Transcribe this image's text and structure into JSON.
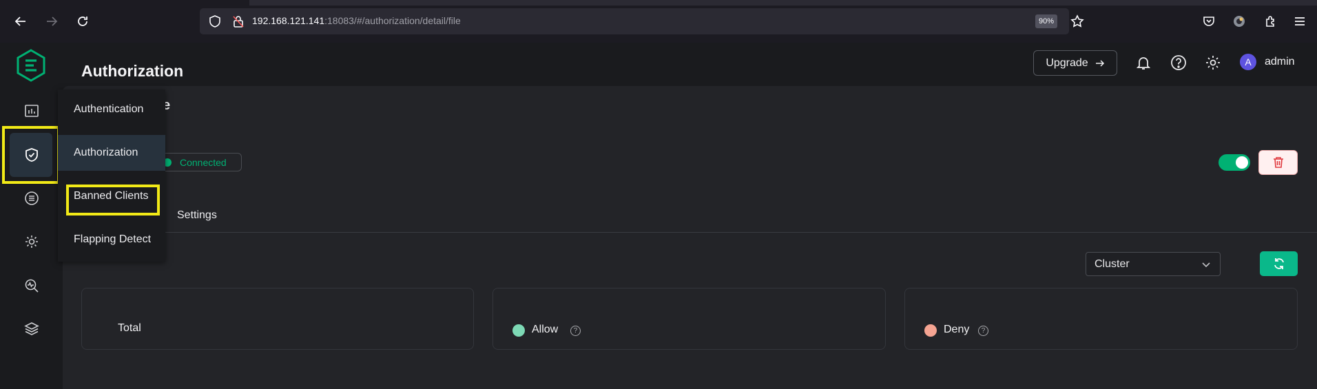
{
  "browser": {
    "url_host": "192.168.121.141",
    "url_rest": ":18083/#/authorization/detail/file",
    "zoom": "90%"
  },
  "header": {
    "upgrade_label": "Upgrade",
    "user_initial": "A",
    "user_name": "admin"
  },
  "sidebar": {
    "items": [
      {
        "icon": "dashboard-icon"
      },
      {
        "icon": "shield-check-icon",
        "active": true
      },
      {
        "icon": "integration-icon"
      },
      {
        "icon": "gear-management-icon"
      },
      {
        "icon": "diagnose-icon"
      },
      {
        "icon": "layers-icon"
      }
    ]
  },
  "submenu": {
    "items": [
      "Authentication",
      "Authorization",
      "Banned Clients",
      "Flapping Detect"
    ],
    "active": "Authorization"
  },
  "page": {
    "title": "Authorization",
    "subtitle_fragment": "e",
    "status": "Connected",
    "enabled": true,
    "tab_settings": "Settings",
    "node_select": "Cluster"
  },
  "cards": [
    {
      "label": "Total"
    },
    {
      "label": "Allow",
      "color": "#7dd9b5"
    },
    {
      "label": "Deny",
      "color": "#f5a492"
    }
  ],
  "colors": {
    "accent": "#00b173",
    "highlight": "#f2ea17"
  }
}
